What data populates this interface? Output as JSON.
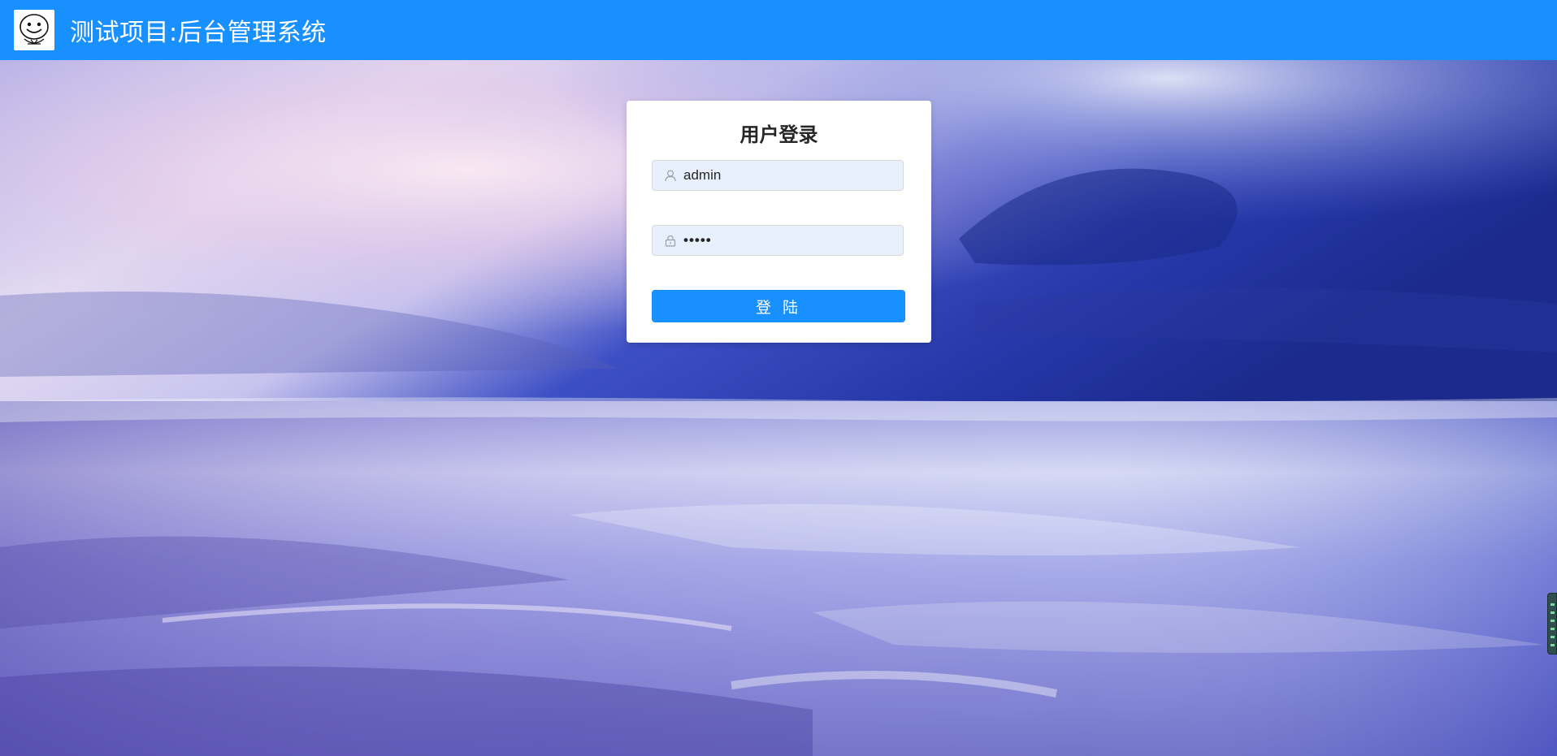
{
  "header": {
    "app_title": "测试项目:后台管理系统",
    "logo_icon": "smiley-face-logo",
    "background_color": "#1890ff"
  },
  "login": {
    "title": "用户登录",
    "username": {
      "icon": "user-icon",
      "value": "admin"
    },
    "password": {
      "icon": "lock-icon",
      "value": "•••••"
    },
    "submit_label": "登 陆",
    "button_color": "#1890ff",
    "field_background": "#e8f0fe"
  },
  "background": {
    "scene": "sky-and-sea",
    "colors": [
      "#e9e6f6",
      "#7d7fd6",
      "#1f2f9a",
      "#3a44b8"
    ]
  }
}
